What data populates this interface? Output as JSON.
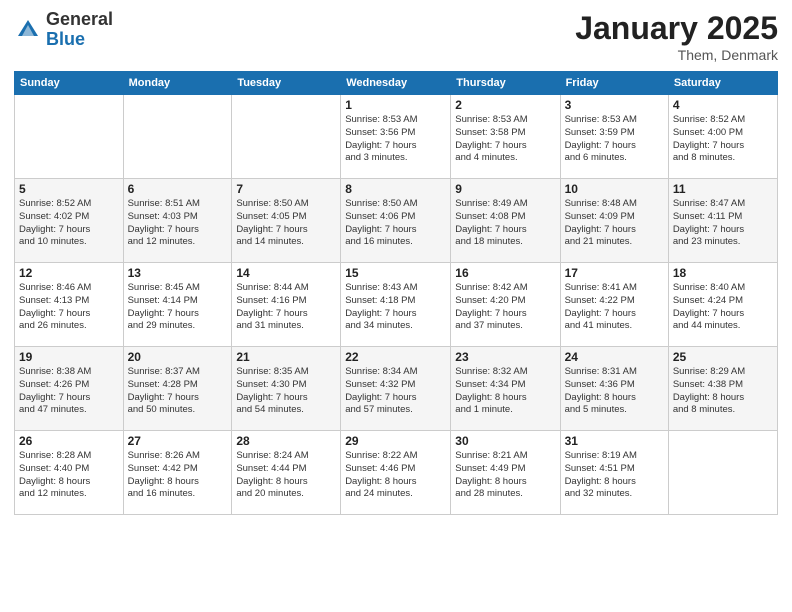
{
  "logo": {
    "general": "General",
    "blue": "Blue"
  },
  "title": "January 2025",
  "subtitle": "Them, Denmark",
  "days_of_week": [
    "Sunday",
    "Monday",
    "Tuesday",
    "Wednesday",
    "Thursday",
    "Friday",
    "Saturday"
  ],
  "weeks": [
    [
      {
        "day": "",
        "info": ""
      },
      {
        "day": "",
        "info": ""
      },
      {
        "day": "",
        "info": ""
      },
      {
        "day": "1",
        "info": "Sunrise: 8:53 AM\nSunset: 3:56 PM\nDaylight: 7 hours\nand 3 minutes."
      },
      {
        "day": "2",
        "info": "Sunrise: 8:53 AM\nSunset: 3:58 PM\nDaylight: 7 hours\nand 4 minutes."
      },
      {
        "day": "3",
        "info": "Sunrise: 8:53 AM\nSunset: 3:59 PM\nDaylight: 7 hours\nand 6 minutes."
      },
      {
        "day": "4",
        "info": "Sunrise: 8:52 AM\nSunset: 4:00 PM\nDaylight: 7 hours\nand 8 minutes."
      }
    ],
    [
      {
        "day": "5",
        "info": "Sunrise: 8:52 AM\nSunset: 4:02 PM\nDaylight: 7 hours\nand 10 minutes."
      },
      {
        "day": "6",
        "info": "Sunrise: 8:51 AM\nSunset: 4:03 PM\nDaylight: 7 hours\nand 12 minutes."
      },
      {
        "day": "7",
        "info": "Sunrise: 8:50 AM\nSunset: 4:05 PM\nDaylight: 7 hours\nand 14 minutes."
      },
      {
        "day": "8",
        "info": "Sunrise: 8:50 AM\nSunset: 4:06 PM\nDaylight: 7 hours\nand 16 minutes."
      },
      {
        "day": "9",
        "info": "Sunrise: 8:49 AM\nSunset: 4:08 PM\nDaylight: 7 hours\nand 18 minutes."
      },
      {
        "day": "10",
        "info": "Sunrise: 8:48 AM\nSunset: 4:09 PM\nDaylight: 7 hours\nand 21 minutes."
      },
      {
        "day": "11",
        "info": "Sunrise: 8:47 AM\nSunset: 4:11 PM\nDaylight: 7 hours\nand 23 minutes."
      }
    ],
    [
      {
        "day": "12",
        "info": "Sunrise: 8:46 AM\nSunset: 4:13 PM\nDaylight: 7 hours\nand 26 minutes."
      },
      {
        "day": "13",
        "info": "Sunrise: 8:45 AM\nSunset: 4:14 PM\nDaylight: 7 hours\nand 29 minutes."
      },
      {
        "day": "14",
        "info": "Sunrise: 8:44 AM\nSunset: 4:16 PM\nDaylight: 7 hours\nand 31 minutes."
      },
      {
        "day": "15",
        "info": "Sunrise: 8:43 AM\nSunset: 4:18 PM\nDaylight: 7 hours\nand 34 minutes."
      },
      {
        "day": "16",
        "info": "Sunrise: 8:42 AM\nSunset: 4:20 PM\nDaylight: 7 hours\nand 37 minutes."
      },
      {
        "day": "17",
        "info": "Sunrise: 8:41 AM\nSunset: 4:22 PM\nDaylight: 7 hours\nand 41 minutes."
      },
      {
        "day": "18",
        "info": "Sunrise: 8:40 AM\nSunset: 4:24 PM\nDaylight: 7 hours\nand 44 minutes."
      }
    ],
    [
      {
        "day": "19",
        "info": "Sunrise: 8:38 AM\nSunset: 4:26 PM\nDaylight: 7 hours\nand 47 minutes."
      },
      {
        "day": "20",
        "info": "Sunrise: 8:37 AM\nSunset: 4:28 PM\nDaylight: 7 hours\nand 50 minutes."
      },
      {
        "day": "21",
        "info": "Sunrise: 8:35 AM\nSunset: 4:30 PM\nDaylight: 7 hours\nand 54 minutes."
      },
      {
        "day": "22",
        "info": "Sunrise: 8:34 AM\nSunset: 4:32 PM\nDaylight: 7 hours\nand 57 minutes."
      },
      {
        "day": "23",
        "info": "Sunrise: 8:32 AM\nSunset: 4:34 PM\nDaylight: 8 hours\nand 1 minute."
      },
      {
        "day": "24",
        "info": "Sunrise: 8:31 AM\nSunset: 4:36 PM\nDaylight: 8 hours\nand 5 minutes."
      },
      {
        "day": "25",
        "info": "Sunrise: 8:29 AM\nSunset: 4:38 PM\nDaylight: 8 hours\nand 8 minutes."
      }
    ],
    [
      {
        "day": "26",
        "info": "Sunrise: 8:28 AM\nSunset: 4:40 PM\nDaylight: 8 hours\nand 12 minutes."
      },
      {
        "day": "27",
        "info": "Sunrise: 8:26 AM\nSunset: 4:42 PM\nDaylight: 8 hours\nand 16 minutes."
      },
      {
        "day": "28",
        "info": "Sunrise: 8:24 AM\nSunset: 4:44 PM\nDaylight: 8 hours\nand 20 minutes."
      },
      {
        "day": "29",
        "info": "Sunrise: 8:22 AM\nSunset: 4:46 PM\nDaylight: 8 hours\nand 24 minutes."
      },
      {
        "day": "30",
        "info": "Sunrise: 8:21 AM\nSunset: 4:49 PM\nDaylight: 8 hours\nand 28 minutes."
      },
      {
        "day": "31",
        "info": "Sunrise: 8:19 AM\nSunset: 4:51 PM\nDaylight: 8 hours\nand 32 minutes."
      },
      {
        "day": "",
        "info": ""
      }
    ]
  ]
}
